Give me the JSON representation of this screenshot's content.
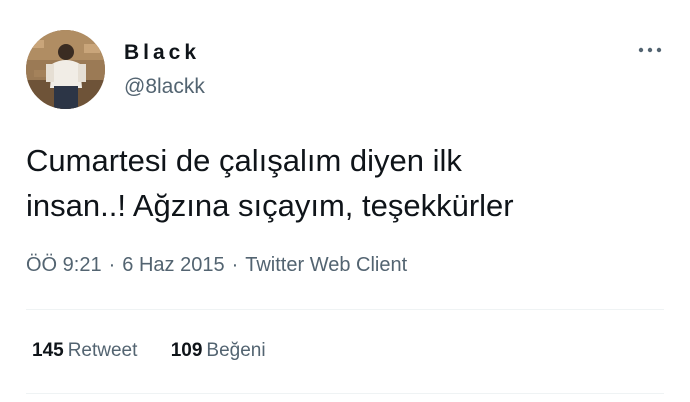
{
  "user": {
    "display_name": "Black",
    "handle": "@8lackk"
  },
  "icons": {
    "more": "more-horizontal-icon",
    "avatar": "avatar"
  },
  "tweet": {
    "text_lines": [
      "Cumartesi de çalışalım diyen ilk",
      "insan..! Ağzına sıçayım, teşekkürler"
    ],
    "time": "ÖÖ 9:21",
    "separator": "·",
    "date": "6 Haz 2015",
    "source": "Twitter Web Client"
  },
  "stats": {
    "retweets_count": "145",
    "retweets_label": "Retweet",
    "likes_count": "109",
    "likes_label": "Beğeni"
  },
  "colors": {
    "text_primary": "#0f1419",
    "text_secondary": "#536471",
    "divider": "#eff3f4"
  }
}
